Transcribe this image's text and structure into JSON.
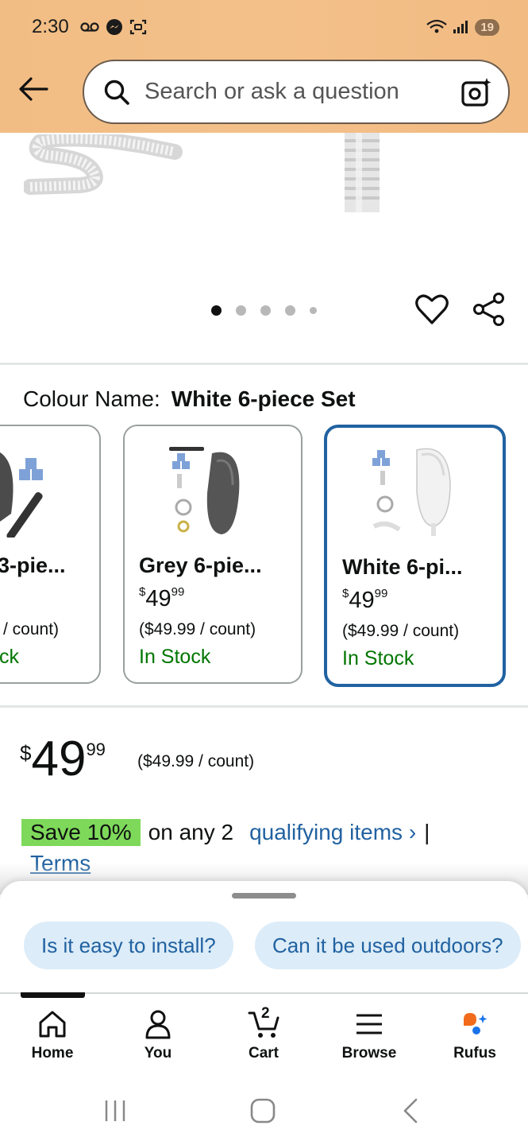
{
  "status_bar": {
    "time": "2:30",
    "battery": "19"
  },
  "search": {
    "placeholder": "Search or ask a question"
  },
  "gallery": {
    "dot_count": 5,
    "active_index": 0
  },
  "variants": {
    "label": "Colour Name:",
    "selected_name": "White 6-piece Set",
    "cards": [
      {
        "title": "3-pie...",
        "price_symbol": "$",
        "price_whole": "49",
        "price_fraction": "99",
        "unit": "/ count)",
        "stock": "ck"
      },
      {
        "title": "Grey 6-pie...",
        "price_symbol": "$",
        "price_whole": "49",
        "price_fraction": "99",
        "unit": "($49.99 / count)",
        "stock": "In Stock"
      },
      {
        "title": "White 6-pi...",
        "price_symbol": "$",
        "price_whole": "49",
        "price_fraction": "99",
        "unit": "($49.99 / count)",
        "stock": "In Stock"
      }
    ]
  },
  "price": {
    "symbol": "$",
    "whole": "49",
    "fraction": "99",
    "unit": "($49.99 / count)"
  },
  "promo": {
    "badge": "Save 10%",
    "text": "on any 2",
    "link": "qualifying items ›",
    "separator": "|",
    "terms": "Terms"
  },
  "suggestions": [
    "Is it easy to install?",
    "Can it be used outdoors?"
  ],
  "nav": {
    "home": "Home",
    "you": "You",
    "cart": "Cart",
    "cart_count": "2",
    "browse": "Browse",
    "rufus": "Rufus"
  },
  "colors": {
    "header": "#f1bd84",
    "link": "#2162a1",
    "in_stock": "#007600",
    "save_badge": "#7ed95b",
    "selected_border": "#2162a1"
  }
}
